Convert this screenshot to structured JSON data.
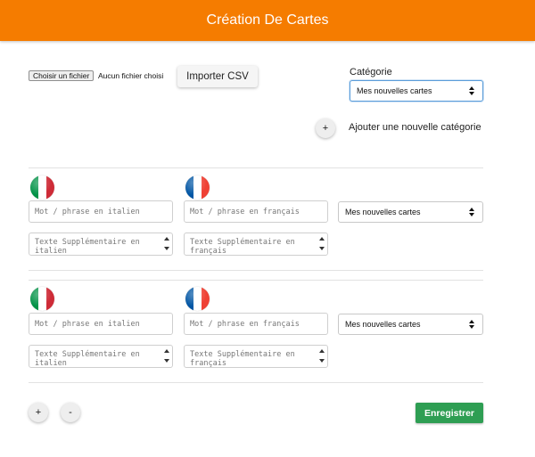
{
  "header": {
    "title": "Création De Cartes"
  },
  "import": {
    "file_button_label": "Choisir un fichier",
    "file_status": "Aucun fichier choisi",
    "import_button_label": "Importer CSV"
  },
  "category": {
    "label": "Catégorie",
    "selected": "Mes nouvelles cartes",
    "add_button_label": "+",
    "add_label": "Ajouter une nouvelle catégorie"
  },
  "flags": {
    "italian_colors": [
      "#009246",
      "#ffffff",
      "#ce2b37"
    ],
    "french_colors": [
      "#0055a4",
      "#ffffff",
      "#ef4135"
    ]
  },
  "cards": [
    {
      "italian_placeholder": "Mot / phrase en italien",
      "french_placeholder": "Mot / phrase en français",
      "italian_extra_placeholder": "Texte Supplémentaire en italien",
      "french_extra_placeholder": "Texte Supplémentaire en français",
      "category_selected": "Mes nouvelles cartes"
    },
    {
      "italian_placeholder": "Mot / phrase en italien",
      "french_placeholder": "Mot / phrase en français",
      "italian_extra_placeholder": "Texte Supplémentaire en italien",
      "french_extra_placeholder": "Texte Supplémentaire en français",
      "category_selected": "Mes nouvelles cartes"
    }
  ],
  "footer": {
    "add_card_label": "+",
    "remove_card_label": "-",
    "save_label": "Enregistrer"
  },
  "colors": {
    "header": "#f57c00",
    "save_button": "#2e9e53"
  }
}
